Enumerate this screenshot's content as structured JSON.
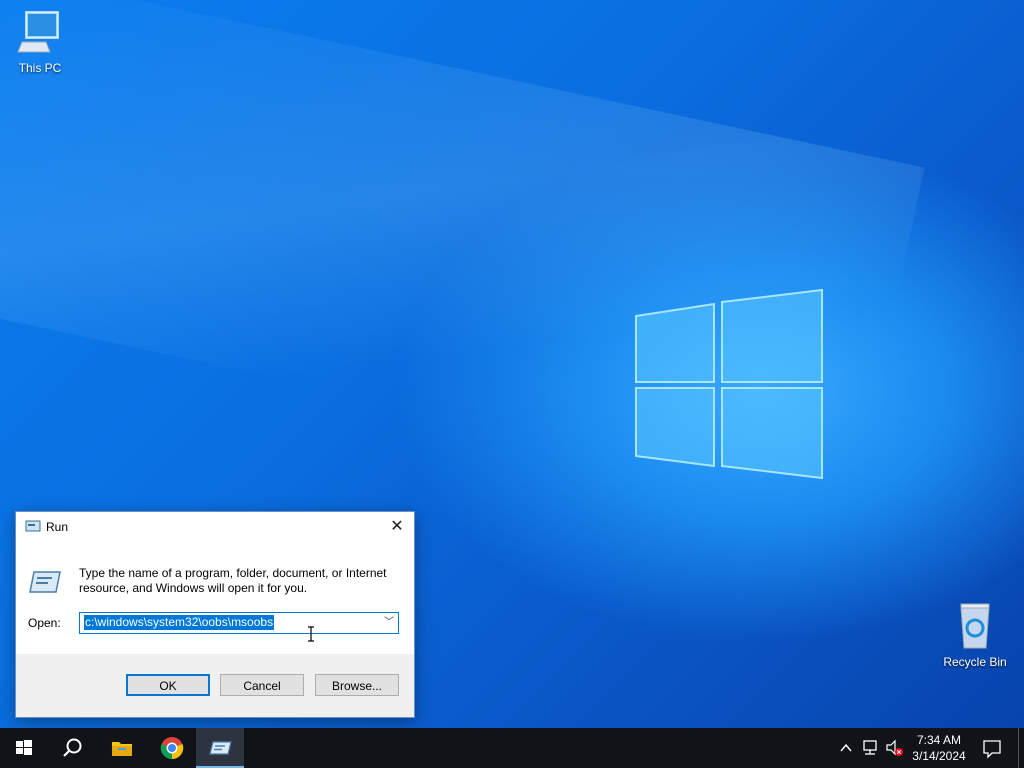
{
  "desktop": {
    "icons": [
      {
        "label": "This PC",
        "icon": "computer-icon"
      },
      {
        "label": "Recycle Bin",
        "icon": "recycle-bin-icon"
      }
    ]
  },
  "run_dialog": {
    "title": "Run",
    "description": "Type the name of a program, folder, document, or Internet resource, and Windows will open it for you.",
    "open_label": "Open:",
    "open_value": "c:\\windows\\system32\\oobs\\msoobs",
    "ok_label": "OK",
    "cancel_label": "Cancel",
    "browse_label": "Browse..."
  },
  "taskbar": {
    "items": [
      "start-icon",
      "search-icon",
      "file-explorer-icon",
      "chrome-icon",
      "run-icon"
    ],
    "clock_time": "7:34 AM",
    "clock_date": "3/14/2024"
  },
  "colors": {
    "accent": "#0078d7",
    "taskbar": "#101317"
  }
}
